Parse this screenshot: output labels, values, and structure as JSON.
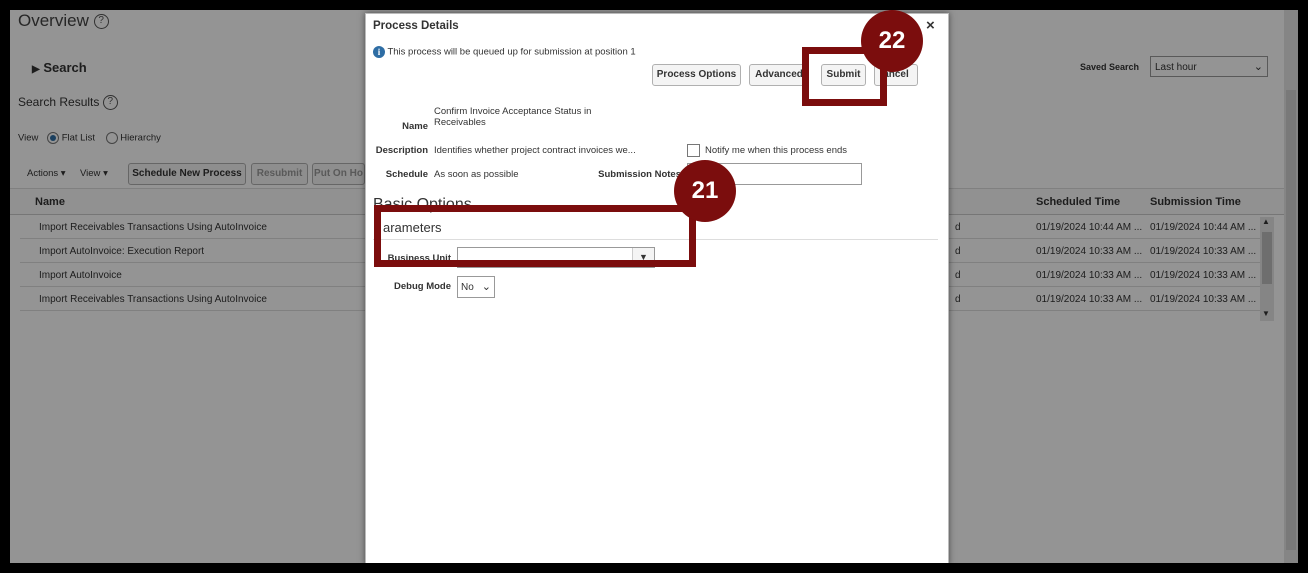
{
  "page": {
    "title": "Overview",
    "search_label": "Search",
    "results_label": "Search Results",
    "saved_search_label": "Saved Search",
    "saved_search_value": "Last hour",
    "view_label": "View",
    "view_options": [
      "Flat List",
      "Hierarchy"
    ]
  },
  "toolbar": {
    "actions": "Actions",
    "view": "View",
    "schedule_new": "Schedule New Process",
    "resubmit": "Resubmit",
    "put_on_hold": "Put On Ho"
  },
  "table": {
    "headers": {
      "name": "Name",
      "scheduled": "Scheduled Time",
      "submission": "Submission Time"
    },
    "rows": [
      {
        "name": "Import Receivables Transactions Using AutoInvoice",
        "status": "d",
        "scheduled": "01/19/2024 10:44 AM ...",
        "submission": "01/19/2024 10:44 AM ..."
      },
      {
        "name": "Import AutoInvoice: Execution Report",
        "status": "d",
        "scheduled": "01/19/2024 10:33 AM ...",
        "submission": "01/19/2024 10:33 AM ..."
      },
      {
        "name": "Import AutoInvoice",
        "status": "d",
        "scheduled": "01/19/2024 10:33 AM ...",
        "submission": "01/19/2024 10:33 AM ..."
      },
      {
        "name": "Import Receivables Transactions Using AutoInvoice",
        "status": "d",
        "scheduled": "01/19/2024 10:33 AM ...",
        "submission": "01/19/2024 10:33 AM ..."
      }
    ]
  },
  "dialog": {
    "title": "Process Details",
    "close": "×",
    "info_text": "This process will be queued up for submission at position 1",
    "buttons": {
      "process_options": "Process Options",
      "advanced": "Advanced",
      "submit": "Submit",
      "cancel": "ancel"
    },
    "name_label": "Name",
    "name_value_line1": "Confirm Invoice Acceptance Status in",
    "name_value_line2": "Receivables",
    "description_label": "Description",
    "description_value": "Identifies whether project contract invoices we...",
    "notify_label": "Notify me when this process ends",
    "schedule_label": "Schedule",
    "schedule_value": "As soon as possible",
    "submission_notes_label": "Submission Notes",
    "basic_options": "Basic Options",
    "parameters": "arameters",
    "business_unit_label": "Business Unit",
    "business_unit_value": "",
    "debug_mode_label": "Debug Mode",
    "debug_mode_value": "No"
  },
  "callouts": {
    "step21": "21",
    "step22": "22"
  },
  "colors": {
    "callout": "#7b0d0d",
    "accent": "#2e6da4"
  }
}
